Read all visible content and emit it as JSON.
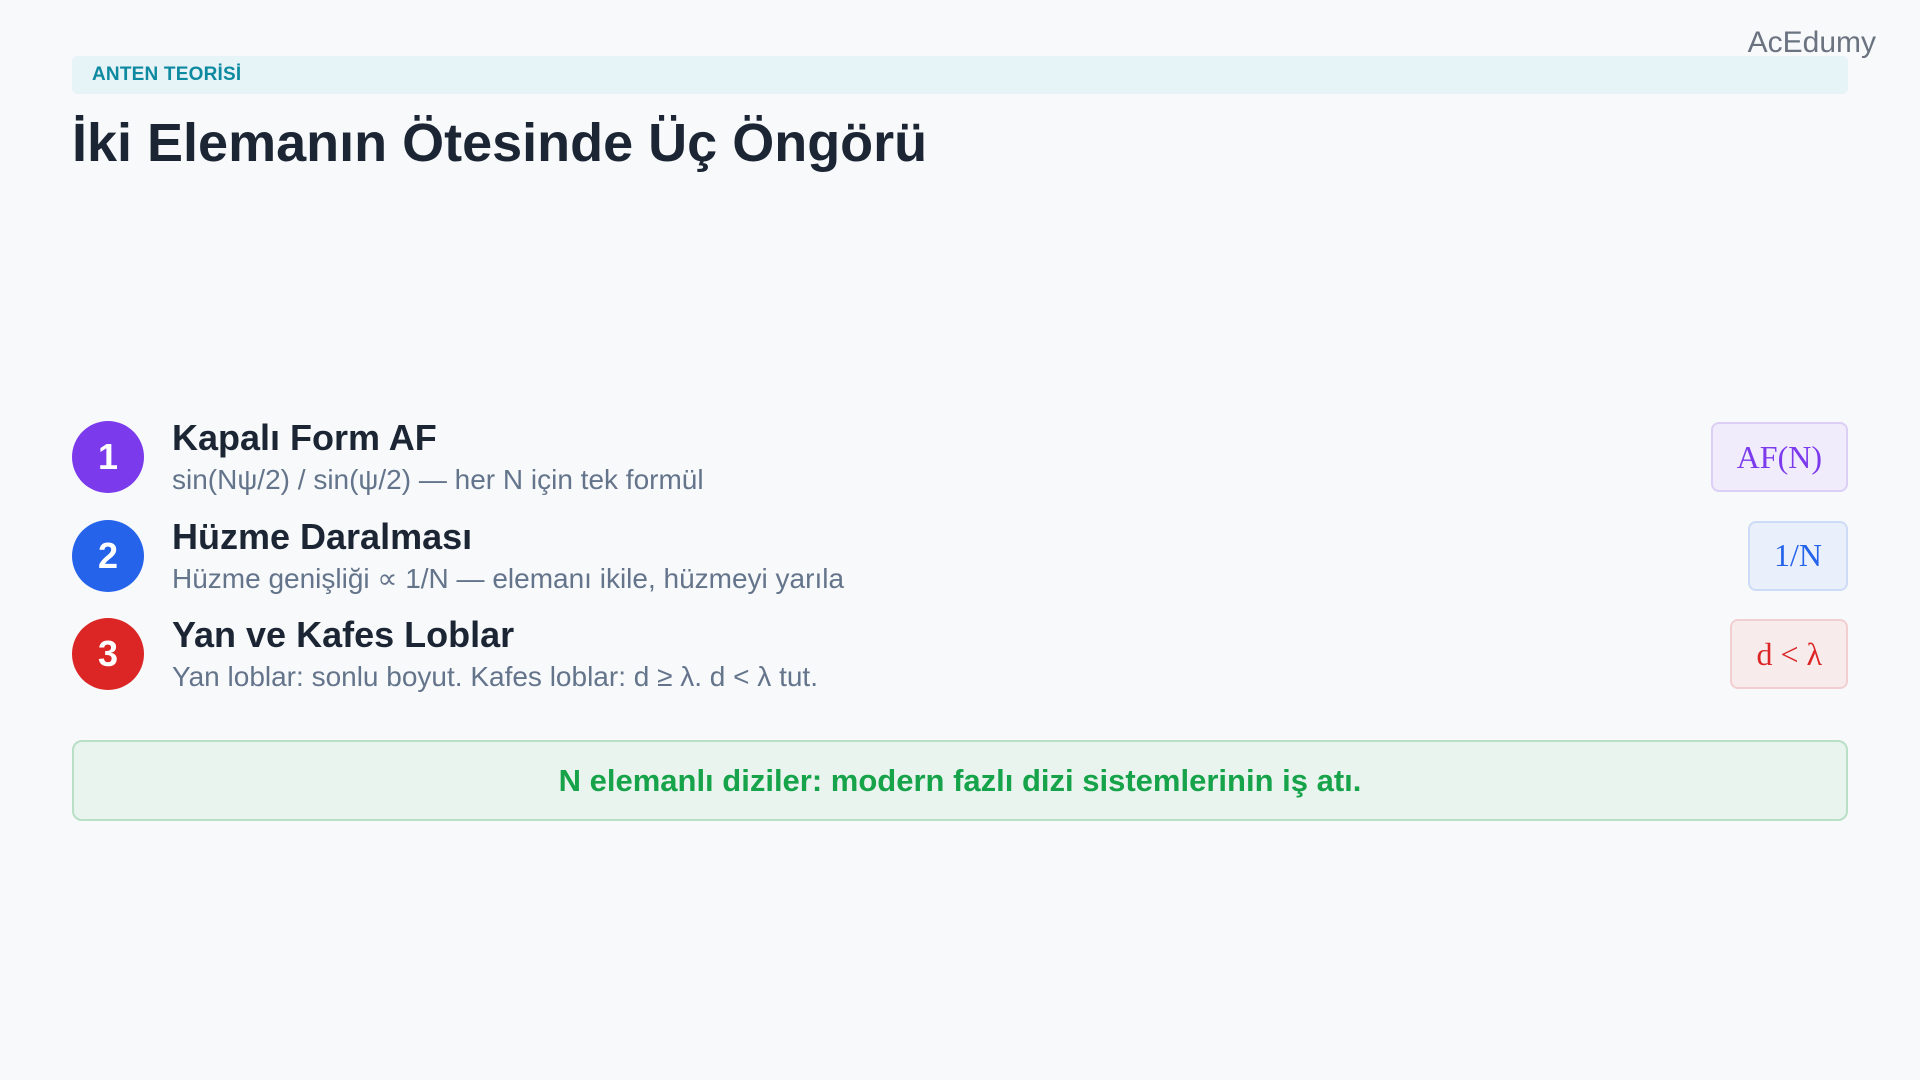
{
  "brand": "AcEdumy",
  "section_tag": "ANTEN TEORİSİ",
  "title": "İki Elemanın Ötesinde Üç Öngörü",
  "items": [
    {
      "number": "1",
      "title": "Kapalı Form AF",
      "description": "sin(Nψ/2) / sin(ψ/2) — her N için tek formül",
      "chip": "AF(N)",
      "accent": "#7c3aed",
      "chip_bg": "#f1ecfb",
      "chip_border": "#dccff5",
      "chip_color": "#7c3aed"
    },
    {
      "number": "2",
      "title": "Hüzme Daralması",
      "description": "Hüzme genişliği ∝ 1/N — elemanı ikile, hüzmeyi yarıla",
      "chip": "1/N",
      "accent": "#2563eb",
      "chip_bg": "#eaf0fb",
      "chip_border": "#cddbf6",
      "chip_color": "#2563eb"
    },
    {
      "number": "3",
      "title": "Yan ve Kafes Loblar",
      "description": "Yan loblar: sonlu boyut. Kafes loblar: d ≥ λ. d < λ tut.",
      "chip": "d < λ",
      "accent": "#dc2626",
      "chip_bg": "#f8ebec",
      "chip_border": "#f1cfd1",
      "chip_color": "#dc2626"
    }
  ],
  "callout": "N elemanlı diziler: modern fazlı dizi sistemlerinin iş atı."
}
